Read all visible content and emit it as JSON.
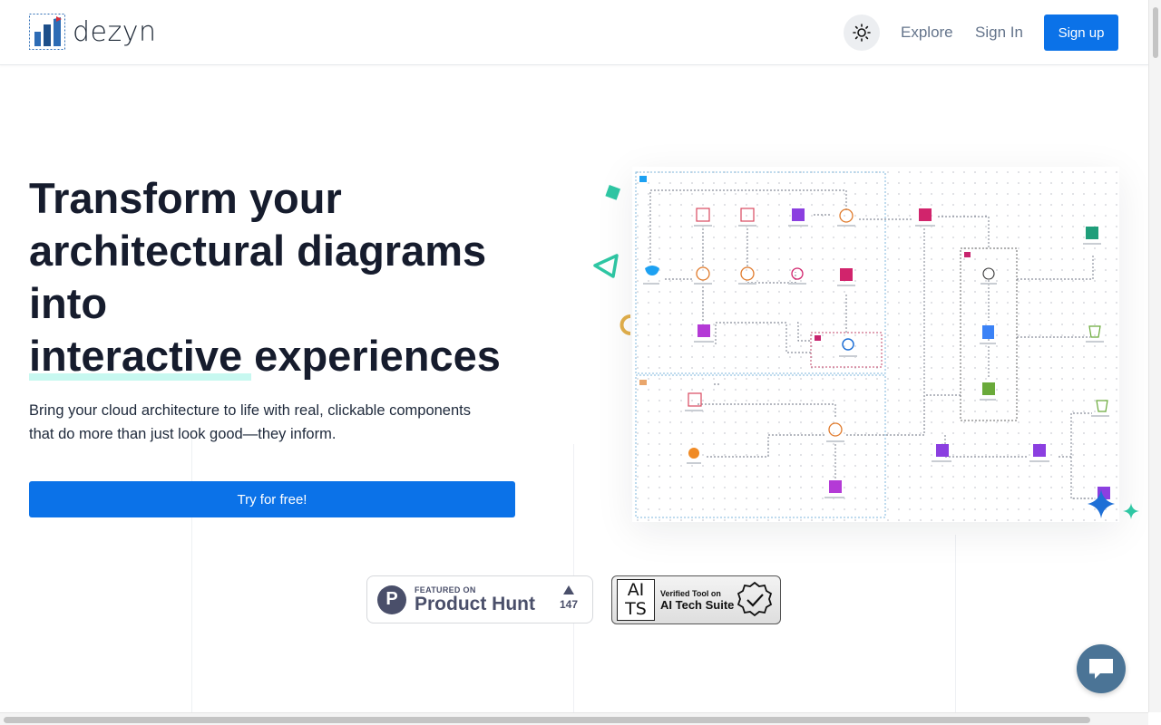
{
  "header": {
    "logo_text": "dezyn",
    "theme_toggle_icon": "sun-icon",
    "nav": {
      "explore": "Explore",
      "sign_in": "Sign In",
      "sign_up": "Sign up"
    }
  },
  "hero": {
    "title_line1": "Transform your",
    "title_line2": "architectural diagrams",
    "title_line3": "into",
    "title_highlight": "interactive",
    "title_line4_rest": " experiences",
    "subtitle_line1": "Bring your cloud architecture to life with real, clickable components",
    "subtitle_line2": "that do more than just look good—they inform.",
    "cta": "Try for free!"
  },
  "badges": {
    "product_hunt": {
      "small": "FEATURED ON",
      "big": "Product Hunt",
      "votes": "147",
      "logo_letter": "P"
    },
    "ai_tech_suite": {
      "box_top": "AI",
      "box_bottom": "TS",
      "small": "Verified Tool on",
      "big": "AI Tech Suite"
    }
  },
  "colors": {
    "primary": "#0b72e8",
    "heading": "#161c2d",
    "highlight": "#5eead4",
    "chat": "#4b7496"
  },
  "chat_icon": "chat-bubble-icon"
}
